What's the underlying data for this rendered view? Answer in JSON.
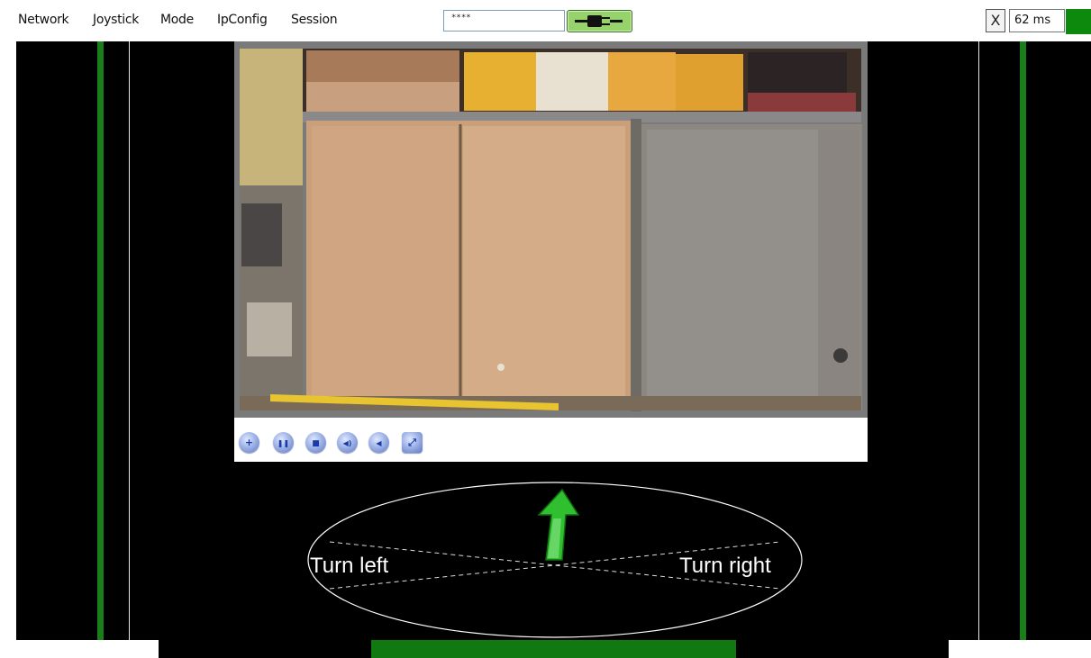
{
  "menubar": {
    "items": [
      {
        "label": "Network"
      },
      {
        "label": "Joystick"
      },
      {
        "label": "Mode"
      },
      {
        "label": "IpConfig"
      },
      {
        "label": "Session"
      }
    ],
    "password_value": "****",
    "connect_icon": "plug-icon",
    "close_label": "X",
    "latency": "62 ms",
    "status_color": "#0d8a0d"
  },
  "controls": {
    "buttons": [
      {
        "name": "zoom-button",
        "icon": "zoom-in-icon",
        "glyph": "+"
      },
      {
        "name": "pause-button",
        "icon": "pause-icon",
        "glyph": "❚❚"
      },
      {
        "name": "stop-button",
        "icon": "stop-icon",
        "glyph": "■"
      },
      {
        "name": "volume-button",
        "icon": "speaker-icon",
        "glyph": "◀)"
      },
      {
        "name": "mute-button",
        "icon": "mute-icon",
        "glyph": "◀"
      },
      {
        "name": "fullscreen-button",
        "icon": "fullscreen-icon",
        "glyph": "⤢"
      }
    ]
  },
  "steering": {
    "left_label": "Turn left",
    "right_label": "Turn right",
    "direction": "forward",
    "arrow_color": "#2fbf2f"
  },
  "colors": {
    "gauge": "#1a7f1a",
    "background": "#000000",
    "throttle": "#107a10"
  }
}
